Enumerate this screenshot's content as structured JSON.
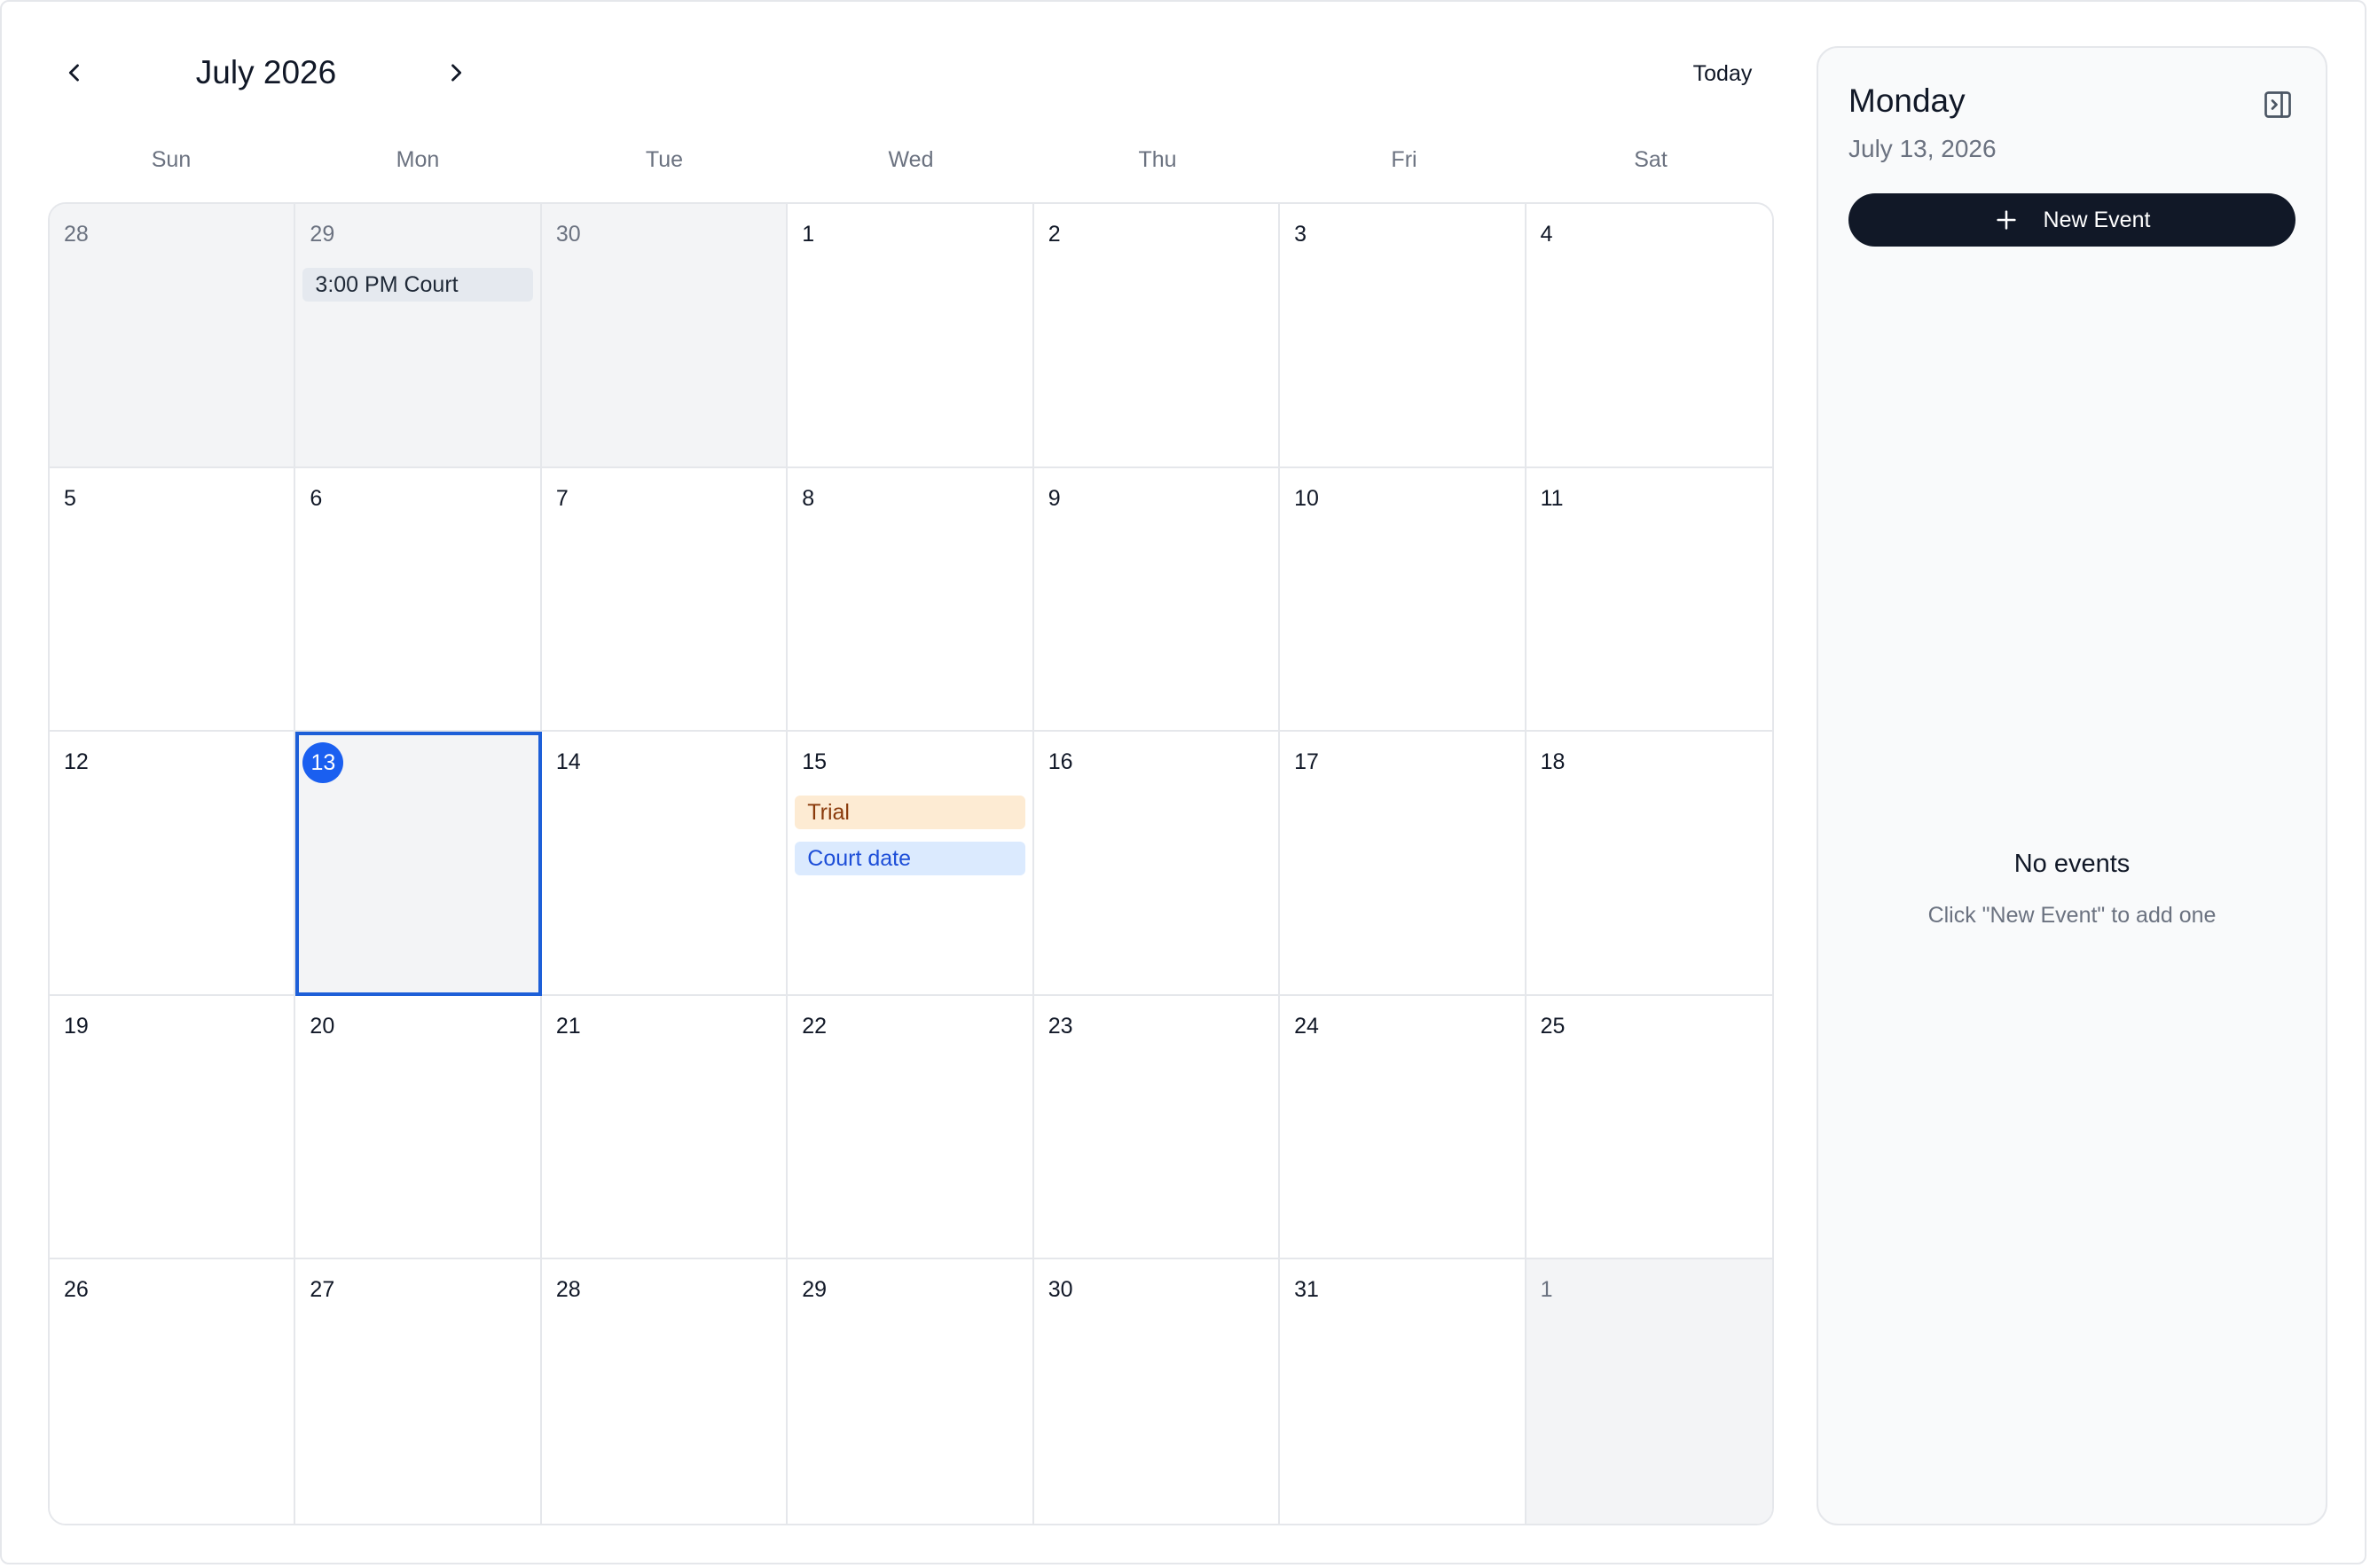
{
  "header": {
    "month_title": "July 2026",
    "today_label": "Today"
  },
  "weekdays": [
    "Sun",
    "Mon",
    "Tue",
    "Wed",
    "Thu",
    "Fri",
    "Sat"
  ],
  "calendar": {
    "weeks": [
      [
        {
          "day": "28",
          "outside": true,
          "events": []
        },
        {
          "day": "29",
          "outside": true,
          "events": [
            {
              "label": "3:00 PM Court",
              "color": "gray"
            }
          ]
        },
        {
          "day": "30",
          "outside": true,
          "events": []
        },
        {
          "day": "1",
          "events": []
        },
        {
          "day": "2",
          "events": []
        },
        {
          "day": "3",
          "events": []
        },
        {
          "day": "4",
          "events": []
        }
      ],
      [
        {
          "day": "5",
          "events": []
        },
        {
          "day": "6",
          "events": []
        },
        {
          "day": "7",
          "events": []
        },
        {
          "day": "8",
          "events": []
        },
        {
          "day": "9",
          "events": []
        },
        {
          "day": "10",
          "events": []
        },
        {
          "day": "11",
          "events": []
        }
      ],
      [
        {
          "day": "12",
          "events": []
        },
        {
          "day": "13",
          "today": true,
          "selected": true,
          "events": []
        },
        {
          "day": "14",
          "events": []
        },
        {
          "day": "15",
          "events": [
            {
              "label": "Trial",
              "color": "orange"
            },
            {
              "label": "Court date",
              "color": "blue"
            }
          ]
        },
        {
          "day": "16",
          "events": []
        },
        {
          "day": "17",
          "events": []
        },
        {
          "day": "18",
          "events": []
        }
      ],
      [
        {
          "day": "19",
          "events": []
        },
        {
          "day": "20",
          "events": []
        },
        {
          "day": "21",
          "events": []
        },
        {
          "day": "22",
          "events": []
        },
        {
          "day": "23",
          "events": []
        },
        {
          "day": "24",
          "events": []
        },
        {
          "day": "25",
          "events": []
        }
      ],
      [
        {
          "day": "26",
          "events": []
        },
        {
          "day": "27",
          "events": []
        },
        {
          "day": "28",
          "events": []
        },
        {
          "day": "29",
          "events": []
        },
        {
          "day": "30",
          "events": []
        },
        {
          "day": "31",
          "events": []
        },
        {
          "day": "1",
          "outside": true,
          "events": []
        }
      ]
    ]
  },
  "panel": {
    "weekday": "Monday",
    "date": "July 13, 2026",
    "new_event_label": "New Event",
    "empty_title": "No events",
    "empty_subtitle": "Click \"New Event\" to add one"
  },
  "colors": {
    "accent": "#1a5ff0",
    "selected_border": "#1d5fd8",
    "primary_button": "#111827",
    "outside_day_bg": "#f3f4f6"
  },
  "icons": {
    "prev": "chevron-left-icon",
    "next": "chevron-right-icon",
    "collapse": "panel-collapse-icon",
    "add": "plus-icon"
  }
}
